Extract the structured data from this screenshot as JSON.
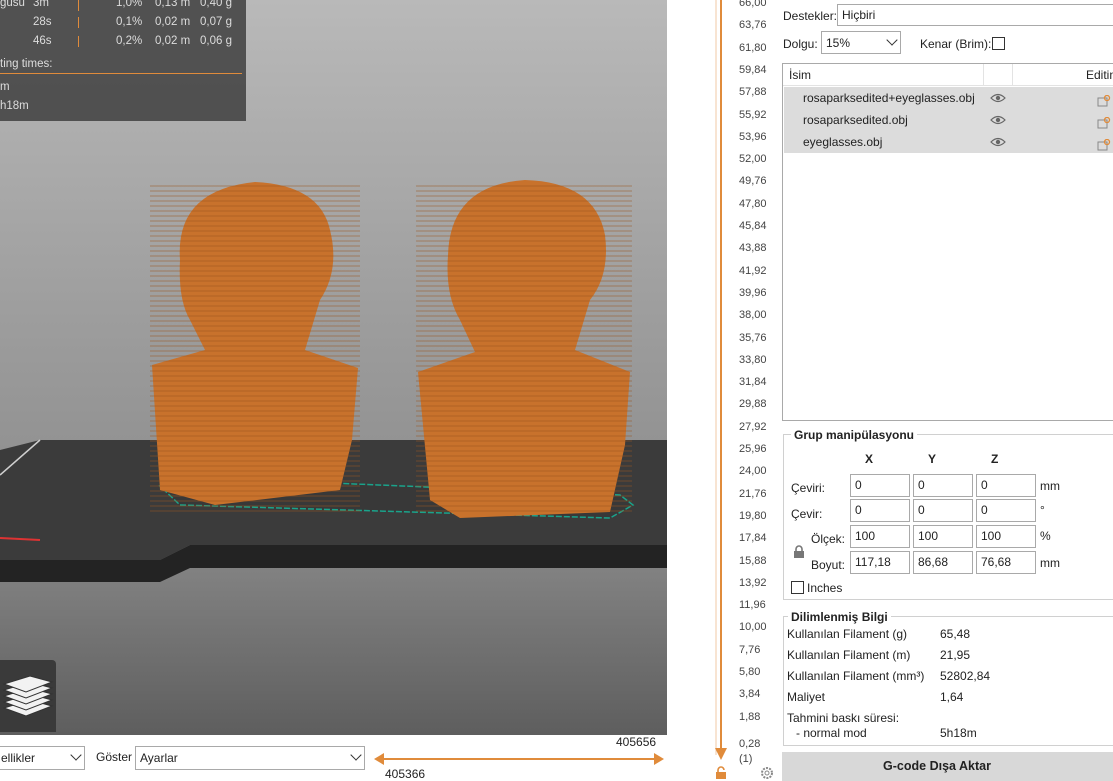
{
  "stats": {
    "rows": [
      {
        "name": "gusu",
        "time": "3m",
        "percent": "1,0%",
        "meters": "0,13 m",
        "grams": "0,40 g"
      },
      {
        "name": "",
        "time": "28s",
        "percent": "0,1%",
        "meters": "0,02 m",
        "grams": "0,07 g"
      },
      {
        "name": "",
        "time": "46s",
        "percent": "0,2%",
        "meters": "0,02 m",
        "grams": "0,06 g"
      }
    ],
    "printing_times_label": "ting times:",
    "line1": "m",
    "line2": "h18m"
  },
  "bottom": {
    "view_combo": "ellikler",
    "show_label": "Göster",
    "show_combo": "Ayarlar",
    "slider_right_value": "405656",
    "slider_left_value": "405366"
  },
  "layer_slider": {
    "ticks": [
      "66,00",
      "63,76",
      "61,80",
      "59,84",
      "57,88",
      "55,92",
      "53,96",
      "52,00",
      "49,76",
      "47,80",
      "45,84",
      "43,88",
      "41,92",
      "39,96",
      "38,00",
      "35,76",
      "33,80",
      "31,84",
      "29,88",
      "27,92",
      "25,96",
      "24,00",
      "21,76",
      "19,80",
      "17,84",
      "15,88",
      "13,92",
      "11,96",
      "10,00",
      "7,76",
      "5,80",
      "3,84",
      "1,88"
    ],
    "bottom_value": "0,28",
    "bottom_index": "(1)"
  },
  "settings": {
    "supports_label": "Destekler:",
    "supports_value": "Hiçbiri",
    "infill_label": "Dolgu:",
    "infill_value": "15%",
    "brim_label": "Kenar (Brim):"
  },
  "object_list": {
    "col_name": "İsim",
    "col_edit": "Editin",
    "items": [
      {
        "name": "rosaparksedited+eyeglasses.obj"
      },
      {
        "name": "rosaparksedited.obj"
      },
      {
        "name": "eyeglasses.obj"
      }
    ]
  },
  "group_manip": {
    "title": "Grup manipülasyonu",
    "axes": [
      "X",
      "Y",
      "Z"
    ],
    "rows": [
      {
        "label": "Çeviri:",
        "values": [
          "0",
          "0",
          "0"
        ],
        "unit": "mm"
      },
      {
        "label": "Çevir:",
        "values": [
          "0",
          "0",
          "0"
        ],
        "unit": "°"
      },
      {
        "label": "Ölçek:",
        "values": [
          "100",
          "100",
          "100"
        ],
        "unit": "%"
      },
      {
        "label": "Boyut:",
        "values": [
          "117,18",
          "86,68",
          "76,68"
        ],
        "unit": "mm"
      }
    ],
    "inches_label": "Inches"
  },
  "sliced_info": {
    "title": "Dilimlenmiş Bilgi",
    "rows": [
      {
        "label": "Kullanılan Filament (g)",
        "value": "65,48"
      },
      {
        "label": "Kullanılan Filament (m)",
        "value": "21,95"
      },
      {
        "label": "Kullanılan Filament (mm³)",
        "value": "52802,84"
      },
      {
        "label": "Maliyet",
        "value": "1,64"
      }
    ],
    "estimated_label": "Tahmini baskı süresi:",
    "mode_label": "- normal mod",
    "mode_value": "5h18m"
  },
  "export_button": "G-code Dışa Aktar",
  "colors": {
    "accent": "#e08b3b",
    "model": "#c8722c",
    "bed": "#3c3c3c"
  }
}
